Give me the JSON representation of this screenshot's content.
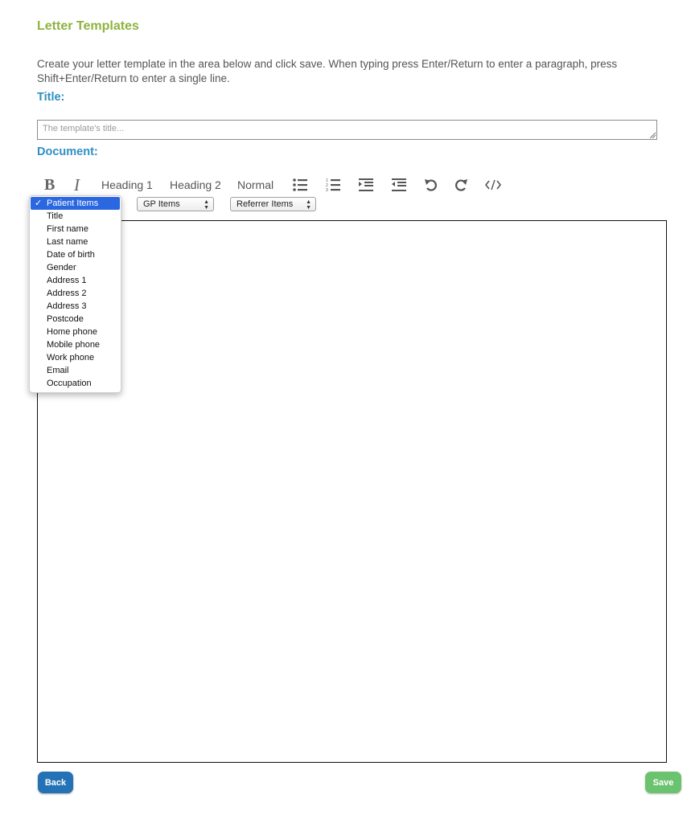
{
  "page": {
    "heading": "Letter Templates",
    "instructions": "Create your letter template in the area below and click save. When typing press Enter/Return to enter a paragraph, press Shift+Enter/Return to enter a single line."
  },
  "title_field": {
    "label": "Title:",
    "placeholder": "The template's title...",
    "value": ""
  },
  "document": {
    "label": "Document:",
    "toolbar": {
      "bold": "B",
      "italic": "I",
      "heading1": "Heading 1",
      "heading2": "Heading 2",
      "normal": "Normal",
      "icons": [
        "bulleted-list-icon",
        "numbered-list-icon",
        "indent-icon",
        "outdent-icon",
        "undo-icon",
        "redo-icon",
        "code-view-icon"
      ]
    },
    "selects": {
      "patient": "Patient Items",
      "gp": "GP Items",
      "referrer": "Referrer Items"
    },
    "patient_dropdown": {
      "selected": "Patient Items",
      "options": [
        "Title",
        "First name",
        "Last name",
        "Date of birth",
        "Gender",
        "Address 1",
        "Address 2",
        "Address 3",
        "Postcode",
        "Home phone",
        "Mobile phone",
        "Work phone",
        "Email",
        "Occupation"
      ]
    },
    "content": ""
  },
  "buttons": {
    "back": "Back",
    "save": "Save"
  },
  "colors": {
    "heading": "#8db33f",
    "label": "#2f8fc4",
    "back_button": "#2472b5",
    "save_button": "#6cc36f",
    "dropdown_highlight": "#2a67e0"
  }
}
